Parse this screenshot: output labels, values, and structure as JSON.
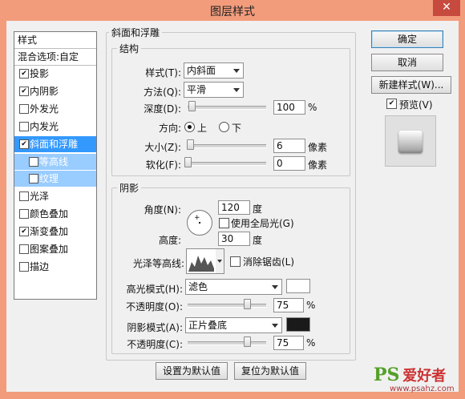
{
  "window": {
    "title": "图层样式",
    "close_glyph": "✕"
  },
  "left_panel": {
    "header": "样式",
    "blend": "混合选项:自定",
    "items": [
      {
        "label": "投影",
        "checked": true
      },
      {
        "label": "内阴影",
        "checked": true
      },
      {
        "label": "外发光",
        "checked": false
      },
      {
        "label": "内发光",
        "checked": false
      },
      {
        "label": "斜面和浮雕",
        "checked": true,
        "selected": true
      },
      {
        "label": "等高线",
        "checked": false,
        "sub": true
      },
      {
        "label": "纹理",
        "checked": false,
        "sub": true
      },
      {
        "label": "光泽",
        "checked": false
      },
      {
        "label": "颜色叠加",
        "checked": false
      },
      {
        "label": "渐变叠加",
        "checked": true
      },
      {
        "label": "图案叠加",
        "checked": false
      },
      {
        "label": "描边",
        "checked": false
      }
    ]
  },
  "bevel": {
    "title": "斜面和浮雕",
    "structure": {
      "title": "结构",
      "style_label": "样式(T):",
      "style_value": "内斜面",
      "method_label": "方法(Q):",
      "method_value": "平滑",
      "depth_label": "深度(D):",
      "depth_value": "100",
      "depth_unit": "%",
      "depth_level_pct": 5,
      "direction_label": "方向:",
      "dir_up": "上",
      "dir_down": "下",
      "dir_selected": "up",
      "size_label": "大小(Z):",
      "size_value": "6",
      "size_unit": "像素",
      "size_level_pct": 3,
      "soften_label": "软化(F):",
      "soften_value": "0",
      "soften_unit": "像素",
      "soften_level_pct": 0
    },
    "shading": {
      "title": "阴影",
      "angle_label": "角度(N):",
      "angle_value": "120",
      "angle_unit": "度",
      "global_light_label": "使用全局光(G)",
      "global_light_checked": false,
      "altitude_label": "高度:",
      "altitude_value": "30",
      "altitude_unit": "度",
      "gloss_label": "光泽等高线:",
      "antialias_label": "消除锯齿(L)",
      "antialias_checked": false,
      "highlight_mode_label": "高光模式(H):",
      "highlight_mode_value": "滤色",
      "highlight_color": "#ffffff",
      "highlight_opacity_label": "不透明度(O):",
      "highlight_opacity_value": "75",
      "highlight_opacity_unit": "%",
      "highlight_opacity_level_pct": 75,
      "shadow_mode_label": "阴影模式(A):",
      "shadow_mode_value": "正片叠底",
      "shadow_color": "#1a1a1a",
      "shadow_opacity_label": "不透明度(C):",
      "shadow_opacity_value": "75",
      "shadow_opacity_unit": "%",
      "shadow_opacity_level_pct": 75
    },
    "set_default": "设置为默认值",
    "reset_default": "复位为默认值"
  },
  "right_panel": {
    "ok": "确定",
    "cancel": "取消",
    "new_style": "新建样式(W)...",
    "preview_label": "预览(V)",
    "preview_checked": true
  },
  "watermark": {
    "ps": "PS",
    "cn": "爱好者",
    "url": "www.psahz.com"
  }
}
